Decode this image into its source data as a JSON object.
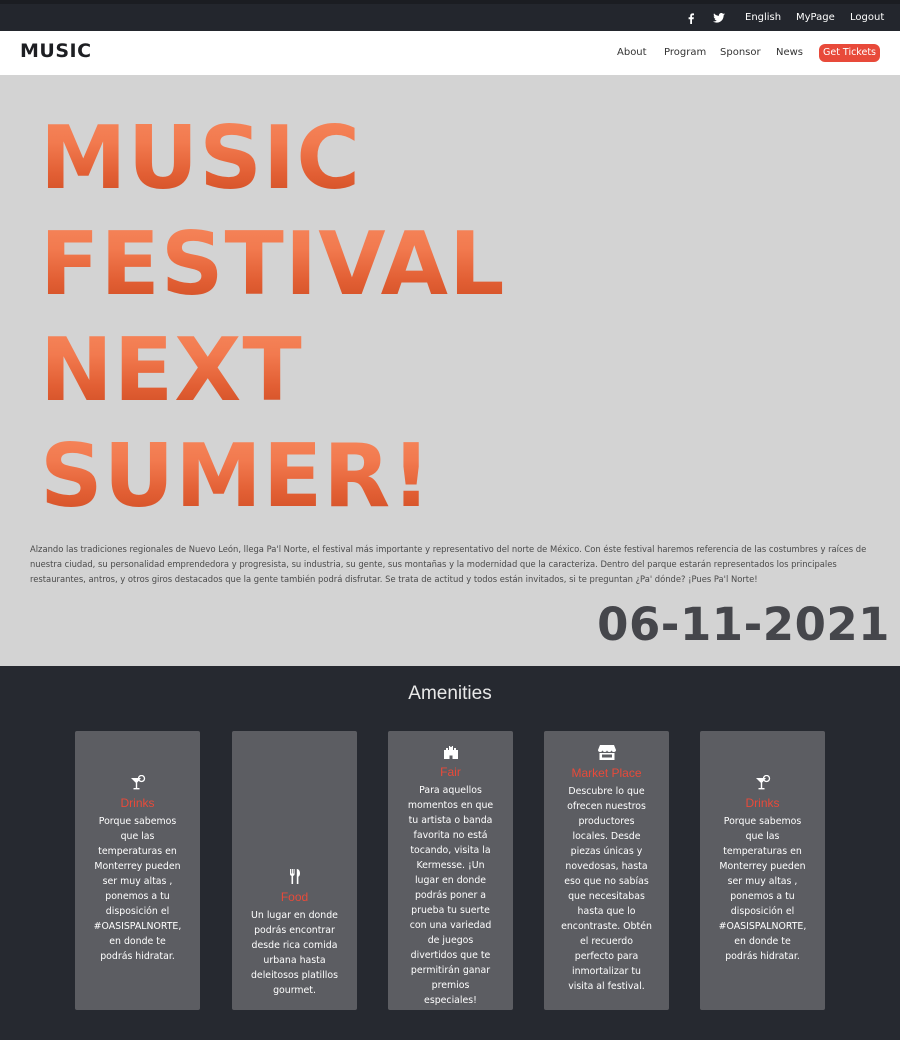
{
  "topbar": {
    "facebook_icon": "facebook-icon",
    "twitter_icon": "twitter-icon",
    "language": "English",
    "mypage": "MyPage",
    "logout": "Logout"
  },
  "nav": {
    "logo": "MUSIC",
    "links": [
      "About",
      "Program",
      "Sponsor",
      "News"
    ],
    "cta": "Get Tickets"
  },
  "hero": {
    "title_lines": [
      "MUSIC",
      "FESTIVAL",
      "NEXT",
      "SUMER!"
    ],
    "description": "Alzando las tradiciones regionales de Nuevo León, llega Pa'l Norte, el festival más importante y representativo del norte de México. Con éste festival haremos referencia de las costumbres y raíces de nuestra ciudad, su personalidad emprendedora y progresista, su industria, su gente, sus montañas y la modernidad que la caracteriza. Dentro del parque estarán representados los principales restaurantes, antros, y otros giros destacados que la gente también podrá disfrutar. Se trata de actitud y todos están invitados, si te preguntan ¿Pa' dónde? ¡Pues Pa'l Norte!",
    "date": "06-11-2021"
  },
  "amenities": {
    "title": "Amenities",
    "cards": [
      {
        "icon": "cocktail-icon",
        "title": "Drinks",
        "text": "Porque sabemos que las temperaturas en Monterrey pueden ser muy altas , ponemos a tu disposición el #OASISPALNORTE, en donde te podrás hidratar."
      },
      {
        "icon": "utensils-icon",
        "title": "Food",
        "text": "Un lugar en donde podrás encontrar desde rica comida urbana hasta deleitosos platillos gourmet."
      },
      {
        "icon": "castle-icon",
        "title": "Fair",
        "text": "Para aquellos momentos en que tu artista o banda favorita no está tocando, visita la Kermesse. ¡Un lugar en donde podrás poner a prueba tu suerte con una variedad de juegos divertidos que te permitirán ganar premios especiales!"
      },
      {
        "icon": "store-icon",
        "title": "Market Place",
        "text": "Descubre lo que ofrecen nuestros productores locales. Desde piezas únicas y novedosas, hasta eso que no sabías que necesitabas hasta que lo encontraste. Obtén el recuerdo perfecto para inmortalizar tu visita al festival."
      },
      {
        "icon": "cocktail-icon",
        "title": "Drinks",
        "text": "Porque sabemos que las temperaturas en Monterrey pueden ser muy altas , ponemos a tu disposición el #OASISPALNORTE, en donde te podrás hidratar."
      }
    ]
  },
  "colors": {
    "topbar_bg": "#23262d",
    "accent": "#e84a3a",
    "hero_bg": "#d3d3d3",
    "amenities_bg": "#262930",
    "card_bg": "#5c5d62"
  }
}
